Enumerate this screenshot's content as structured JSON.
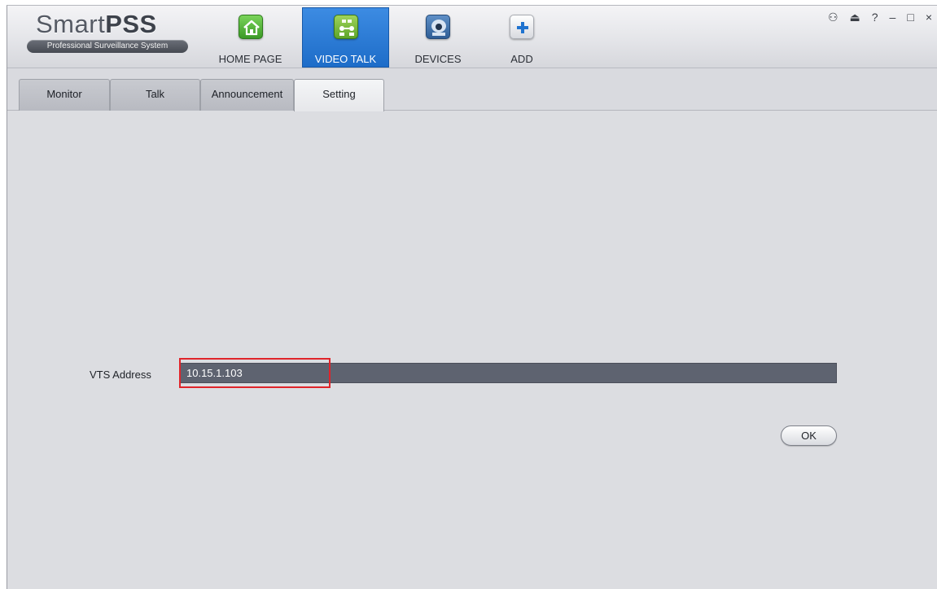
{
  "app": {
    "logo_light": "Smart",
    "logo_bold": "PSS",
    "logo_subtitle": "Professional Surveillance System"
  },
  "nav": {
    "items": [
      {
        "label": "HOME PAGE",
        "icon": "home-icon",
        "active": false
      },
      {
        "label": "VIDEO TALK",
        "icon": "video-talk-icon",
        "active": true
      },
      {
        "label": "DEVICES",
        "icon": "devices-icon",
        "active": false
      },
      {
        "label": "ADD",
        "icon": "add-icon",
        "active": false
      }
    ]
  },
  "window_controls": {
    "user": "⚇",
    "lock": "⏏",
    "help": "?",
    "minimize": "–",
    "maximize": "□",
    "close": "×"
  },
  "tabs": [
    {
      "label": "Monitor",
      "active": false
    },
    {
      "label": "Talk",
      "active": false
    },
    {
      "label": "Announcement",
      "active": false
    },
    {
      "label": "Setting",
      "active": true
    }
  ],
  "settings": {
    "vts_label": "VTS Address",
    "vts_value": "10.15.1.103",
    "ok_label": "OK"
  },
  "colors": {
    "accent_active_tab": "#1d6cc8",
    "highlight_border": "#e0242a",
    "input_background": "#5e6370"
  }
}
